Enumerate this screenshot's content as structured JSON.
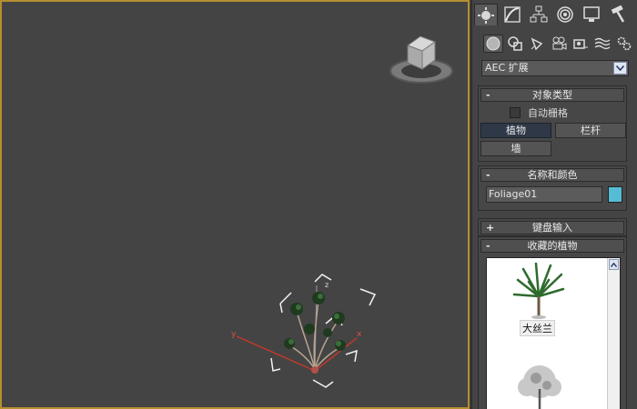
{
  "viewport": {
    "gizmo_axes": {
      "x": "x",
      "y": "y",
      "z": "z"
    }
  },
  "command_panel": {
    "tabs": [
      "create-tab",
      "modify-tab",
      "hierarchy-tab",
      "motion-tab",
      "display-tab",
      "utilities-tab"
    ],
    "categories": [
      "geometry",
      "shapes",
      "lights",
      "cameras",
      "helpers",
      "space-warps",
      "systems"
    ],
    "category_select": "AEC 扩展",
    "object_type": {
      "title": "对象类型",
      "auto_grid": "自动栅格",
      "buttons": {
        "foliage": "植物",
        "railing": "栏杆",
        "wall": "墙"
      }
    },
    "name_color": {
      "title": "名称和颜色",
      "name": "Foliage01",
      "color": "#56bcd6"
    },
    "keyboard_entry": {
      "title": "键盘输入",
      "sign": "+"
    },
    "favorite_plants": {
      "title": "收藏的植物",
      "items": [
        {
          "label": "大丝兰"
        }
      ]
    },
    "collapse_sign": "-"
  },
  "colors": {
    "viewport_border": "#b58f2f",
    "accent_pressed": "#2f3846"
  }
}
